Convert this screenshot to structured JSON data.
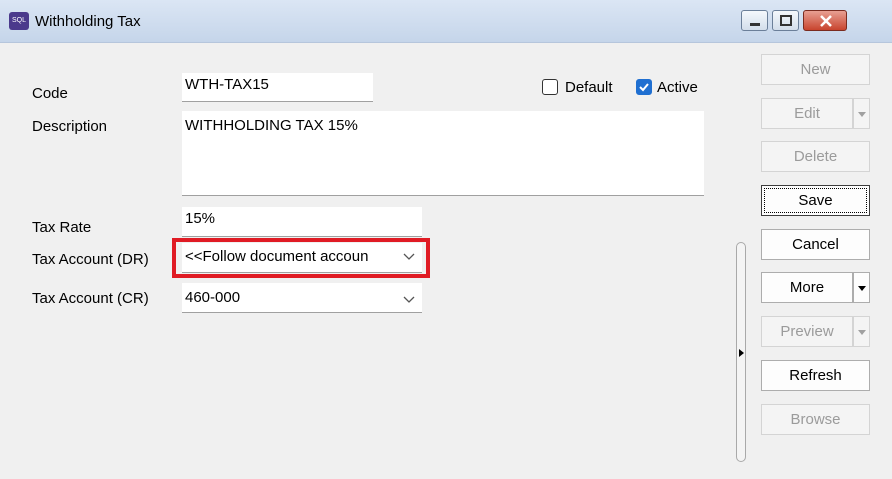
{
  "window": {
    "title": "Withholding Tax",
    "app_icon_text": "SQL"
  },
  "form": {
    "code_label": "Code",
    "code_value": "WTH-TAX15",
    "default_label": "Default",
    "default_checked": false,
    "active_label": "Active",
    "active_checked": true,
    "description_label": "Description",
    "description_value": "WITHHOLDING TAX 15%",
    "tax_rate_label": "Tax Rate",
    "tax_rate_value": "15%",
    "tax_account_dr_label": "Tax Account (DR)",
    "tax_account_dr_value": "<<Follow document accoun",
    "tax_account_cr_label": "Tax Account (CR)",
    "tax_account_cr_value": "460-000"
  },
  "buttons": {
    "new": "New",
    "edit": "Edit",
    "delete": "Delete",
    "save": "Save",
    "cancel": "Cancel",
    "more": "More",
    "preview": "Preview",
    "refresh": "Refresh",
    "browse": "Browse"
  },
  "colors": {
    "highlight": "#e01b24",
    "checkbox_active": "#1f6fd1"
  }
}
